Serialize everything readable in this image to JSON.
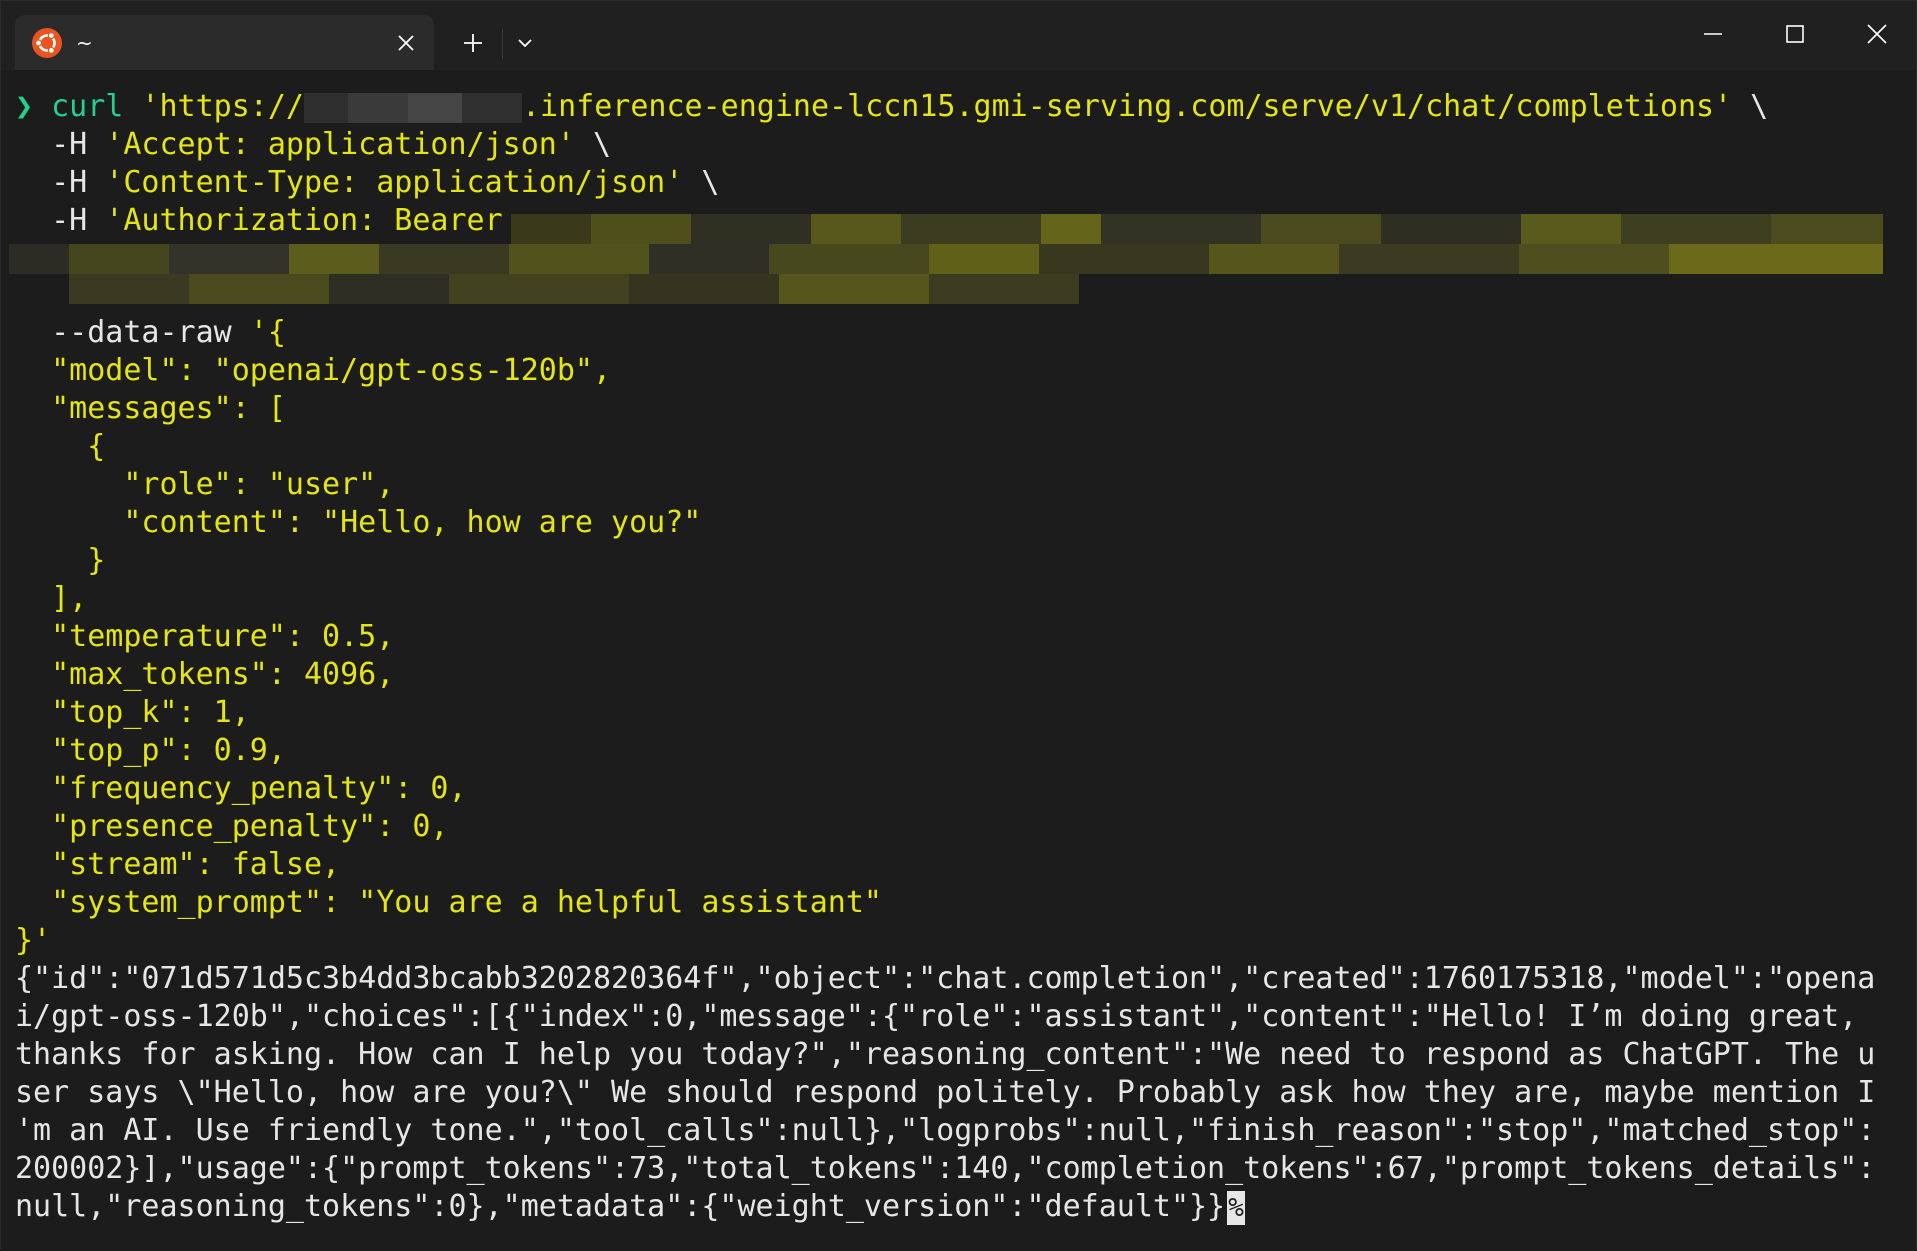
{
  "tab": {
    "title": "~",
    "icon": "ubuntu-icon"
  },
  "window_controls": [
    "minimize-icon",
    "maximize-icon",
    "close-icon"
  ],
  "colors": {
    "prompt": "#23d18b",
    "string": "#e5e510",
    "text": "#e6e6e6",
    "background": "#1c1c1c"
  },
  "command": {
    "prompt_symbol": "❯",
    "line1_cmd": "curl",
    "line1_pre": " 'https://",
    "line1_post": ".inference-engine-lccn15.gmi-serving.com/serve/v1/chat/completions'",
    "line1_cont": " \\",
    "line2_flag": "  -H ",
    "line2_str": "'Accept: application/json'",
    "line2_cont": " \\",
    "line3_flag": "  -H ",
    "line3_str": "'Content-Type: application/json'",
    "line3_cont": " \\",
    "line4_flag": "  -H ",
    "line4_str": "'Authorization: Bearer",
    "data_raw_flag": "  --data-raw ",
    "data_raw_open": "'{",
    "body_lines": [
      "  \"model\": \"openai/gpt-oss-120b\",",
      "  \"messages\": [",
      "    {",
      "      \"role\": \"user\",",
      "      \"content\": \"Hello, how are you?\"",
      "    }",
      "  ],",
      "  \"temperature\": 0.5,",
      "  \"max_tokens\": 4096,",
      "  \"top_k\": 1,",
      "  \"top_p\": 0.9,",
      "  \"frequency_penalty\": 0,",
      "  \"presence_penalty\": 0,",
      "  \"stream\": false,",
      "  \"system_prompt\": \"You are a helpful assistant\"",
      "}'"
    ]
  },
  "output_lines": [
    "{\"id\":\"071d571d5c3b4dd3bcabb3202820364f\",\"object\":\"chat.completion\",\"created\":1760175318,\"model\":\"opena",
    "i/gpt-oss-120b\",\"choices\":[{\"index\":0,\"message\":{\"role\":\"assistant\",\"content\":\"Hello! I’m doing great,",
    "thanks for asking. How can I help you today?\",\"reasoning_content\":\"We need to respond as ChatGPT. The u",
    "ser says \\\"Hello, how are you?\\\" We should respond politely. Probably ask how they are, maybe mention I",
    "'m an AI. Use friendly tone.\",\"tool_calls\":null},\"logprobs\":null,\"finish_reason\":\"stop\",\"matched_stop\":",
    "200002}],\"usage\":{\"prompt_tokens\":73,\"total_tokens\":140,\"completion_tokens\":67,\"prompt_tokens_details\":",
    "null,\"reasoning_tokens\":0},\"metadata\":{\"weight_version\":\"default\"}}"
  ],
  "end_marker": "%"
}
